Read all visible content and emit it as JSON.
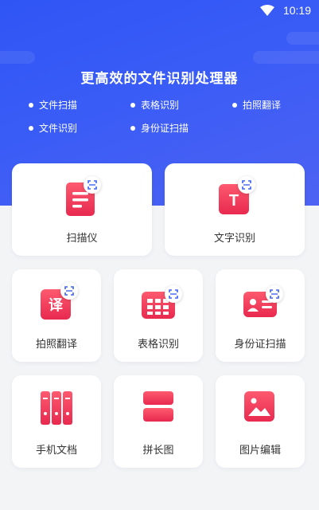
{
  "status_bar": {
    "time": "10:19",
    "wifi_icon": "wifi-icon"
  },
  "hero": {
    "title": "更高效的文件识别处理器",
    "features": [
      "文件扫描",
      "表格识别",
      "拍照翻译",
      "文件识别",
      "身份证扫描"
    ]
  },
  "tools": {
    "scanner": {
      "label": "扫描仪",
      "icon": "document-scan-icon"
    },
    "text_recognition": {
      "label": "文字识别",
      "icon": "text-t-icon",
      "glyph": "T"
    },
    "photo_translate": {
      "label": "拍照翻译",
      "icon": "translate-icon",
      "glyph": "译"
    },
    "table_recognition": {
      "label": "表格识别",
      "icon": "table-icon"
    },
    "id_card_scan": {
      "label": "身份证扫描",
      "icon": "id-card-icon"
    },
    "phone_documents": {
      "label": "手机文档",
      "icon": "binders-icon"
    },
    "long_image": {
      "label": "拼长图",
      "icon": "stitch-image-icon"
    },
    "image_edit": {
      "label": "图片编辑",
      "icon": "picture-icon"
    }
  },
  "colors": {
    "hero_blue": "#3358f5",
    "icon_gradient_start": "#fd5a6f",
    "icon_gradient_end": "#e8294f",
    "scan_badge_blue": "#3e63f2"
  }
}
